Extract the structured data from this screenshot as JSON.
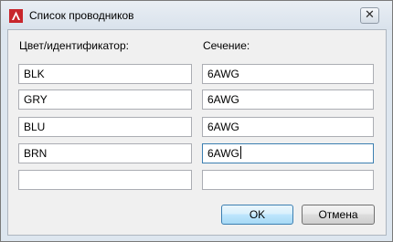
{
  "window": {
    "title": "Список проводников",
    "close_glyph": "✕",
    "app_icon": "autocad-icon",
    "close_icon": "close-icon"
  },
  "columns": {
    "color_label": "Цвет/идентификатор:",
    "size_label": "Сечение:"
  },
  "rows": [
    {
      "color": "BLK",
      "size": "6AWG"
    },
    {
      "color": "GRY",
      "size": "6AWG"
    },
    {
      "color": "BLU",
      "size": "6AWG"
    },
    {
      "color": "BRN",
      "size": "6AWG"
    },
    {
      "color": "",
      "size": ""
    }
  ],
  "buttons": {
    "ok_label": "OK",
    "cancel_label": "Отмена"
  },
  "colors": {
    "accent_red": "#c8262c",
    "focus_border": "#3c7fb1"
  }
}
